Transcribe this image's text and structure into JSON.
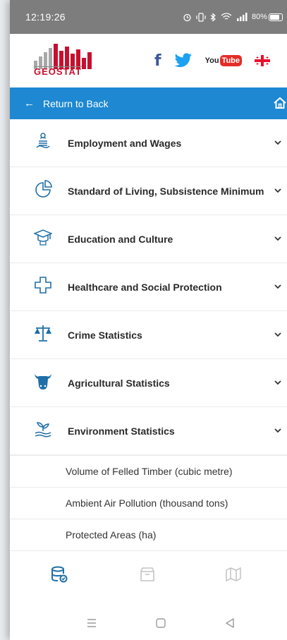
{
  "status": {
    "time": "12:19:26",
    "battery": "80%",
    "battery_level": 0.8
  },
  "header": {
    "logo_text": "GEOSTAT",
    "social": {
      "facebook": "f",
      "youtube_you": "You",
      "youtube_tube": "Tube"
    }
  },
  "nav": {
    "back_arrow": "←",
    "back_label": "Return to Back"
  },
  "categories": [
    {
      "label": "Employment and Wages",
      "icon": "money-hand-icon"
    },
    {
      "label": "Standard of Living, Subsistence Minimum",
      "icon": "pie-chart-icon"
    },
    {
      "label": "Education and Culture",
      "icon": "graduation-cap-icon"
    },
    {
      "label": "Healthcare and Social Protection",
      "icon": "medical-cross-icon"
    },
    {
      "label": "Crime Statistics",
      "icon": "scales-icon"
    },
    {
      "label": "Agricultural Statistics",
      "icon": "cow-icon"
    },
    {
      "label": "Environment Statistics",
      "icon": "plant-hand-icon"
    }
  ],
  "environment_subitems": [
    {
      "label": "Volume of Felled Timber (cubic metre)"
    },
    {
      "label": "Ambient Air Pollution (thousand tons)"
    },
    {
      "label": "Protected Areas (ha)"
    }
  ],
  "tabs": [
    {
      "icon": "database-icon",
      "active": true
    },
    {
      "icon": "archive-icon",
      "active": false
    },
    {
      "icon": "map-icon",
      "active": false
    }
  ],
  "colors": {
    "accent": "#1e88d2",
    "status_bar": "#7d7d7d",
    "logo_red": "#c8102e",
    "icon_blue": "#1f6fa8",
    "inactive_icon": "#c4c4c4"
  }
}
